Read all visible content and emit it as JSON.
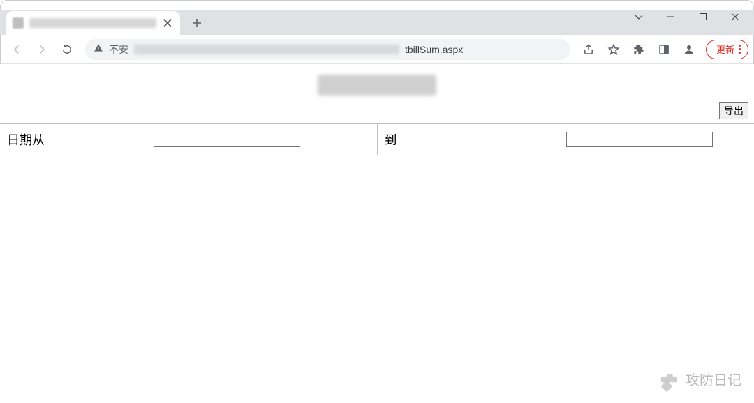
{
  "window": {
    "update_label": "更新"
  },
  "omnibox": {
    "security_label": "不安",
    "url_suffix": "tbillSum.aspx"
  },
  "page": {
    "export_label": "导出",
    "date_from_label": "日期从",
    "date_to_label": "到",
    "date_from_value": "",
    "date_to_value": ""
  },
  "watermark": {
    "text": "攻防日记"
  }
}
